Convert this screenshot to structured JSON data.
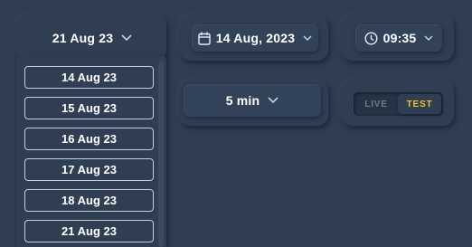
{
  "date_select": {
    "value": "21 Aug 23"
  },
  "date_picker": {
    "value": "14 Aug, 2023",
    "icon": "calendar-icon"
  },
  "time_picker": {
    "value": "09:35",
    "icon": "clock-icon"
  },
  "interval_select": {
    "value": "5 min"
  },
  "mode_toggle": {
    "options": [
      "LIVE",
      "TEST"
    ],
    "selected": "TEST"
  },
  "date_options": [
    "14 Aug 23",
    "15 Aug 23",
    "16 Aug 23",
    "17 Aug 23",
    "18 Aug 23",
    "21 Aug 23"
  ],
  "colors": {
    "background": "#2f3e52",
    "accent": "#f2c12e",
    "text": "#ffffff",
    "muted": "#6f7c8e"
  }
}
